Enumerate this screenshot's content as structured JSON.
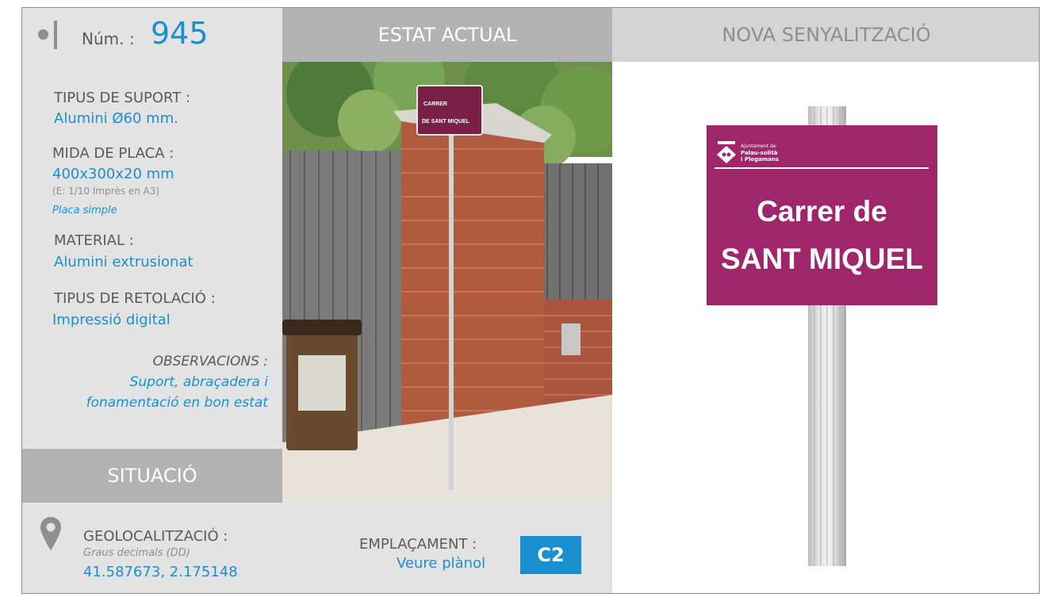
{
  "header": {
    "num_label": "Núm. :",
    "num_value": "945",
    "estat_actual": "ESTAT ACTUAL",
    "nova_senyalitzacio": "NOVA SENYALITZACIÓ"
  },
  "info": {
    "tipus_suport_label": "TIPUS DE SUPORT :",
    "tipus_suport_value": "Alumini Ø60 mm.",
    "mida_placa_label": "MIDA DE PLACA :",
    "mida_placa_value": "400x300x20 mm",
    "mida_placa_scale": "(E: 1/10 Imprès en A3)",
    "mida_placa_type": "Placa simple",
    "material_label": "MATERIAL :",
    "material_value": "Alumini extrusionat",
    "retolacio_label": "TIPUS DE RETOLACIÓ :",
    "retolacio_value": "Impressió digital",
    "observacions_label": "OBSERVACIONS :",
    "observacions_line1": "Suport, abraçadera i",
    "observacions_line2": "fonamentació en bon estat"
  },
  "situacio": {
    "title": "SITUACIÓ",
    "geo_label": "GEOLOCALITZACIÓ :",
    "geo_format": "Graus decimals (DD)",
    "geo_value": "41.587673, 2.175148",
    "emplacament_label": "EMPLAÇAMENT :",
    "emplacament_link": "Veure plànol",
    "emplacament_code": "C2"
  },
  "photo_sign": {
    "line1": "CARRER",
    "line2": "DE SANT MIQUEL"
  },
  "new_sign": {
    "logo_line1": "Ajuntament de",
    "logo_line2": "Palau-solità",
    "logo_line3": "i Plegamans",
    "line1": "Carrer de",
    "line2": "SANT MIQUEL"
  },
  "colors": {
    "accent_blue": "#1a8fd0",
    "sign_magenta": "#a0266c",
    "panel_gray": "#e3e3e3",
    "header_gray": "#b3b3b3"
  },
  "icons": [
    "location-pin-icon",
    "bullet-dot-icon"
  ]
}
